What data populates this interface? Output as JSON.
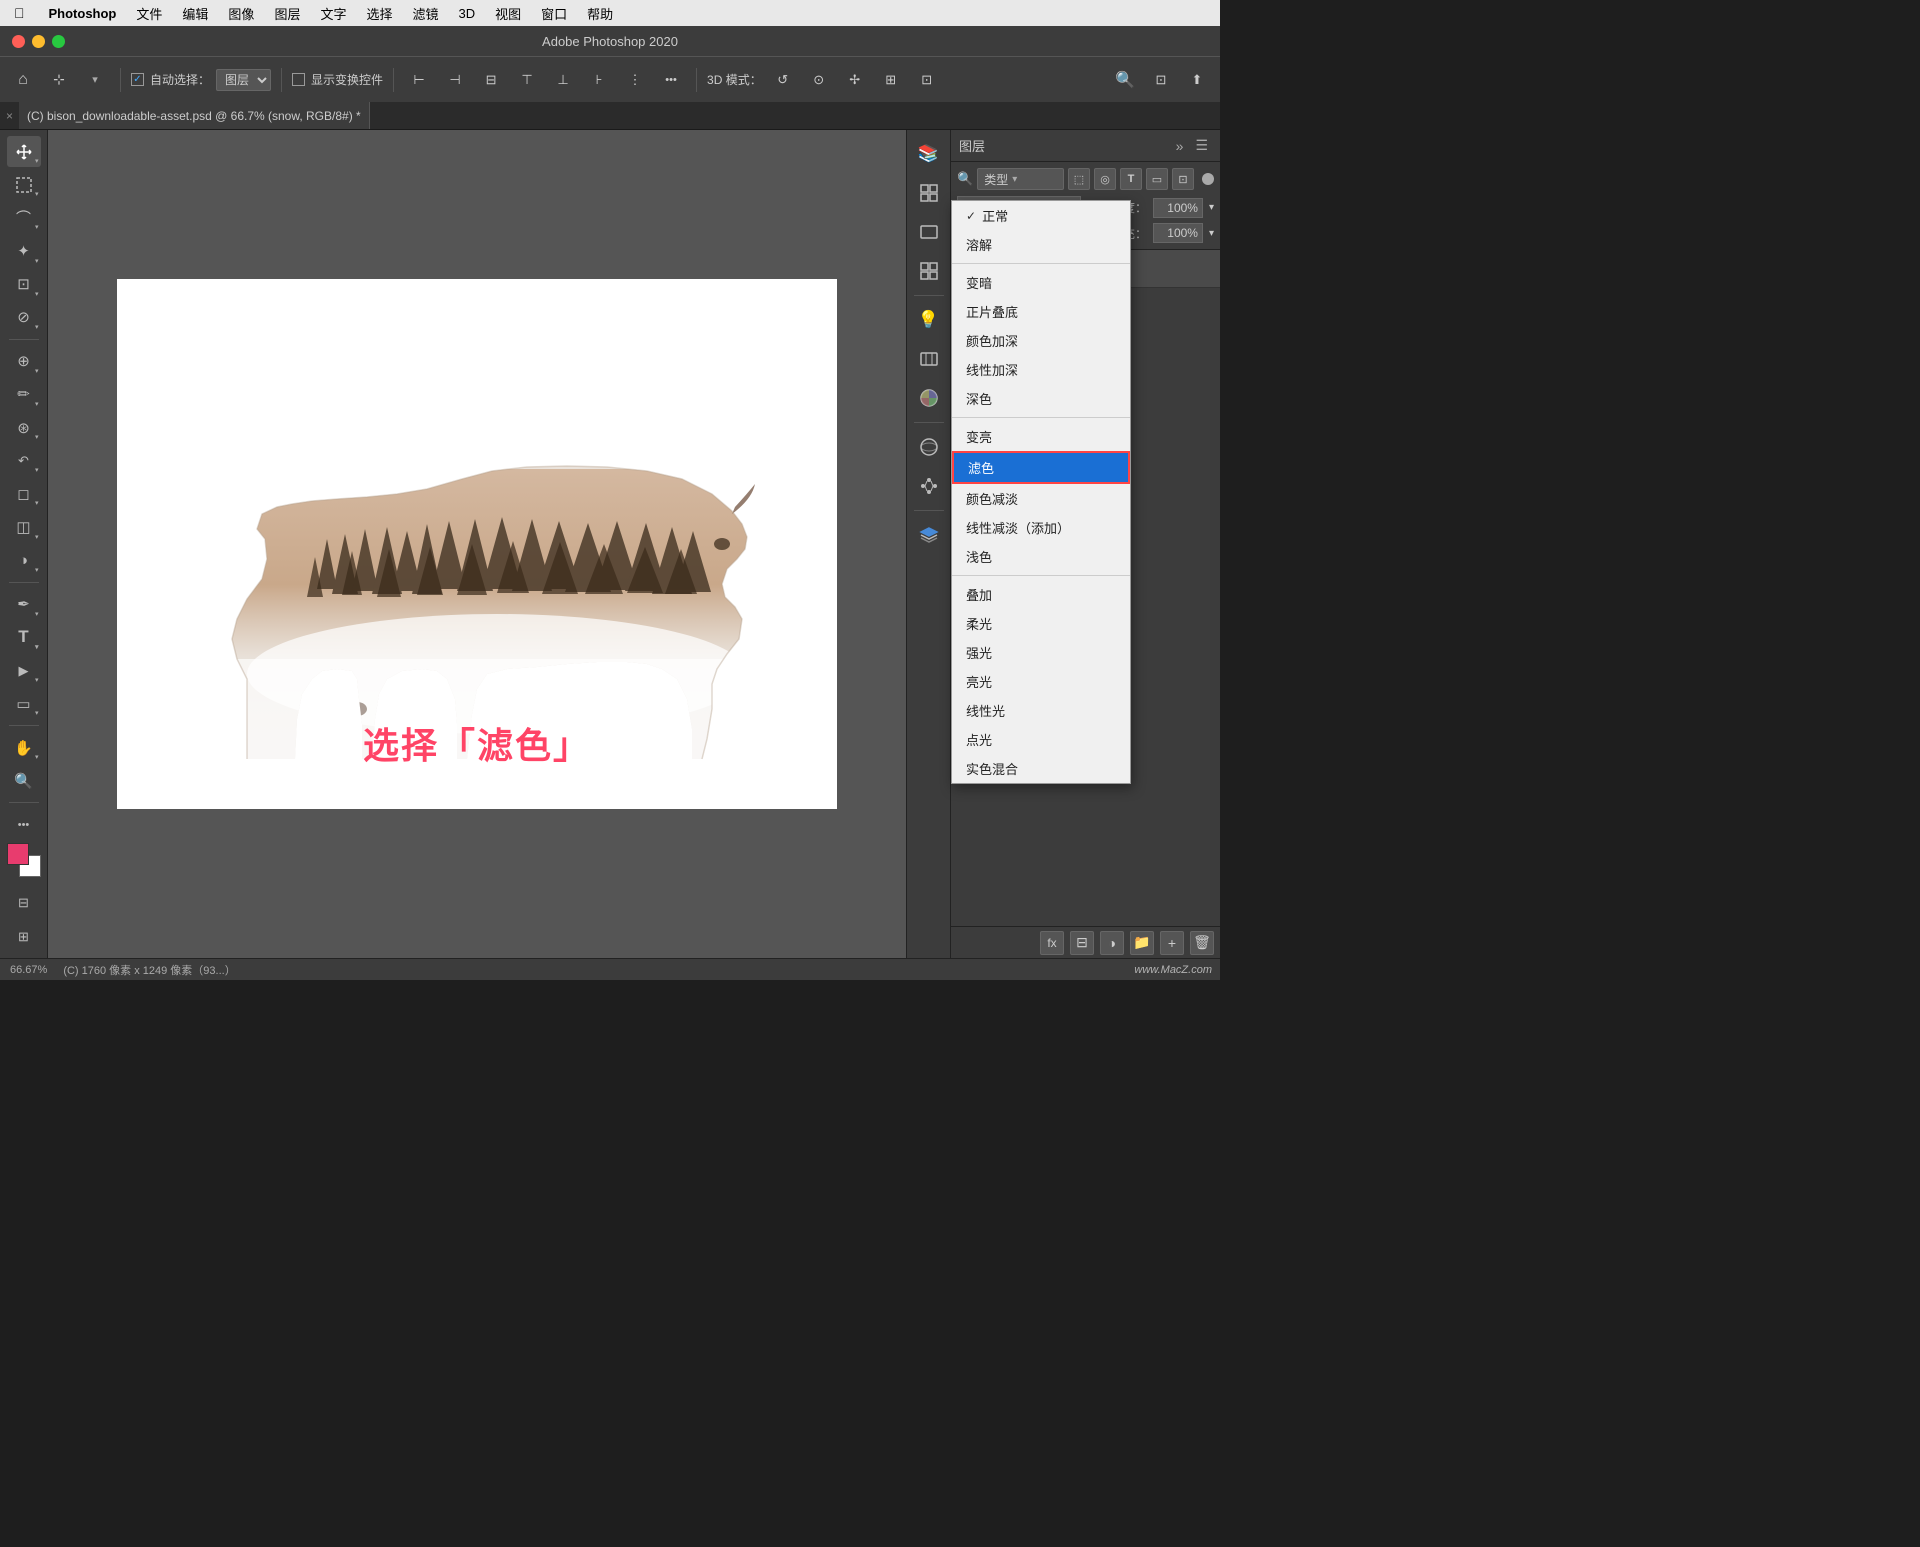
{
  "menubar": {
    "apple": "",
    "items": [
      "Photoshop",
      "文件",
      "编辑",
      "图像",
      "图层",
      "文字",
      "选择",
      "滤镜",
      "3D",
      "视图",
      "窗口",
      "帮助"
    ]
  },
  "titlebar": {
    "title": "Adobe Photoshop 2020"
  },
  "toolbar": {
    "auto_select_label": "自动选择：",
    "layer_label": "图层",
    "show_transform_label": "显示变换控件",
    "mode_3d": "3D 模式："
  },
  "tab": {
    "close": "×",
    "title": "(C) bison_downloadable-asset.psd @ 66.7% (snow, RGB/8#) *"
  },
  "canvas": {
    "overlay_text": "选择「滤色」"
  },
  "layers_panel": {
    "title": "图层",
    "search_placeholder": "类型",
    "opacity_label": "不透明度：",
    "opacity_value": "100%",
    "fill_label": "填充：",
    "fill_value": "100%"
  },
  "blend_modes": {
    "group1": [
      {
        "label": "正常",
        "checked": true,
        "selected": false
      },
      {
        "label": "溶解",
        "checked": false,
        "selected": false
      }
    ],
    "group2": [
      {
        "label": "变暗",
        "checked": false,
        "selected": false
      },
      {
        "label": "正片叠底",
        "checked": false,
        "selected": false
      },
      {
        "label": "颜色加深",
        "checked": false,
        "selected": false
      },
      {
        "label": "线性加深",
        "checked": false,
        "selected": false
      },
      {
        "label": "深色",
        "checked": false,
        "selected": false
      }
    ],
    "group3": [
      {
        "label": "变亮",
        "checked": false,
        "selected": false
      },
      {
        "label": "滤色",
        "checked": false,
        "selected": true
      },
      {
        "label": "颜色减淡",
        "checked": false,
        "selected": false
      },
      {
        "label": "线性减淡（添加）",
        "checked": false,
        "selected": false
      },
      {
        "label": "浅色",
        "checked": false,
        "selected": false
      }
    ],
    "group4": [
      {
        "label": "叠加",
        "checked": false,
        "selected": false
      },
      {
        "label": "柔光",
        "checked": false,
        "selected": false
      },
      {
        "label": "强光",
        "checked": false,
        "selected": false
      },
      {
        "label": "亮光",
        "checked": false,
        "selected": false
      },
      {
        "label": "线性光",
        "checked": false,
        "selected": false
      },
      {
        "label": "点光",
        "checked": false,
        "selected": false
      },
      {
        "label": "实色混合",
        "checked": false,
        "selected": false
      }
    ]
  },
  "status_bar": {
    "zoom": "66.67%",
    "info": "(C) 1760 像素 x 1249 像素（93...）"
  },
  "watermark": "www.MacZ.com",
  "icons": {
    "move": "✥",
    "marquee": "⬚",
    "lasso": "⌒",
    "magic_wand": "✦",
    "crop": "⊡",
    "eyedropper": "⊘",
    "healing": "⊕",
    "brush": "✏",
    "clone": "⊛",
    "eraser": "◻",
    "gradient": "◫",
    "dodge": "◑",
    "pen": "✒",
    "text": "T",
    "path_sel": "▶",
    "shape": "◻",
    "hand": "✋",
    "zoom": "🔍",
    "more": "···"
  }
}
